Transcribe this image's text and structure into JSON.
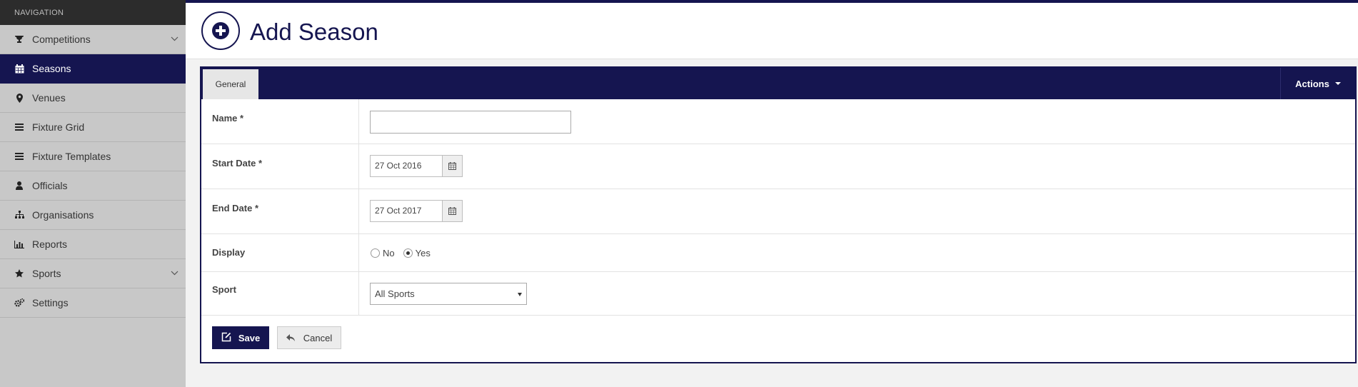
{
  "nav": {
    "header": "NAVIGATION",
    "items": [
      {
        "label": "Competitions",
        "icon": "trophy-icon"
      },
      {
        "label": "Seasons",
        "icon": "calendar-icon"
      },
      {
        "label": "Venues",
        "icon": "map-marker-icon"
      },
      {
        "label": "Fixture Grid",
        "icon": "list-icon"
      },
      {
        "label": "Fixture Templates",
        "icon": "list-icon"
      },
      {
        "label": "Officials",
        "icon": "user-icon"
      },
      {
        "label": "Organisations",
        "icon": "sitemap-icon"
      },
      {
        "label": "Reports",
        "icon": "bar-chart-icon"
      },
      {
        "label": "Sports",
        "icon": "star-icon"
      },
      {
        "label": "Settings",
        "icon": "cogs-icon"
      }
    ],
    "active": "Seasons"
  },
  "header": {
    "title": "Add Season",
    "icon": "plus-circle-icon"
  },
  "panel": {
    "tab": "General",
    "actions_label": "Actions",
    "fields": {
      "name_label": "Name *",
      "name_value": "",
      "start_label": "Start Date *",
      "start_value": "27 Oct 2016",
      "end_label": "End Date *",
      "end_value": "27 Oct 2017",
      "display_label": "Display",
      "display_no": "No",
      "display_yes": "Yes",
      "display_selected": "Yes",
      "sport_label": "Sport",
      "sport_value": "All Sports"
    },
    "save_label": "Save",
    "cancel_label": "Cancel"
  },
  "colors": {
    "brand": "#151550",
    "sidebar": "#c8c8c8"
  }
}
